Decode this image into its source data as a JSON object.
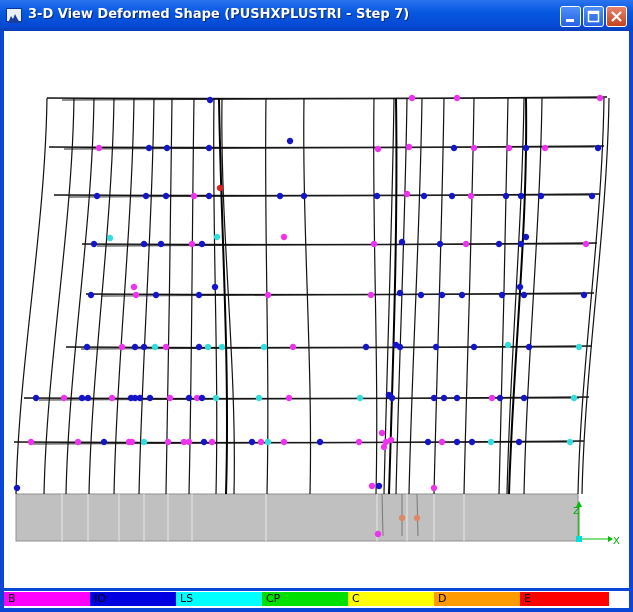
{
  "window": {
    "title": "3-D View  Deformed Shape (PUSHXPLUSTRI - Step 7)",
    "icon": "app-icon",
    "buttons": [
      "minimize-icon",
      "maximize-icon",
      "close-icon"
    ]
  },
  "axes": {
    "x_label": "X",
    "z_label": "Z"
  },
  "legend": [
    {
      "label": "B",
      "color": "#ff00ff"
    },
    {
      "label": "IO",
      "color": "#0000e0"
    },
    {
      "label": "LS",
      "color": "#00ffff"
    },
    {
      "label": "CP",
      "color": "#00e000"
    },
    {
      "label": "C",
      "color": "#ffff00"
    },
    {
      "label": "D",
      "color": "#ff9a00"
    },
    {
      "label": "E",
      "color": "#ff0000"
    }
  ],
  "hinge_colors": {
    "B": "#ee33ee",
    "IO": "#1414c8",
    "LS": "#33dddd",
    "E": "#dd2222",
    "D": "#dd8866"
  }
}
